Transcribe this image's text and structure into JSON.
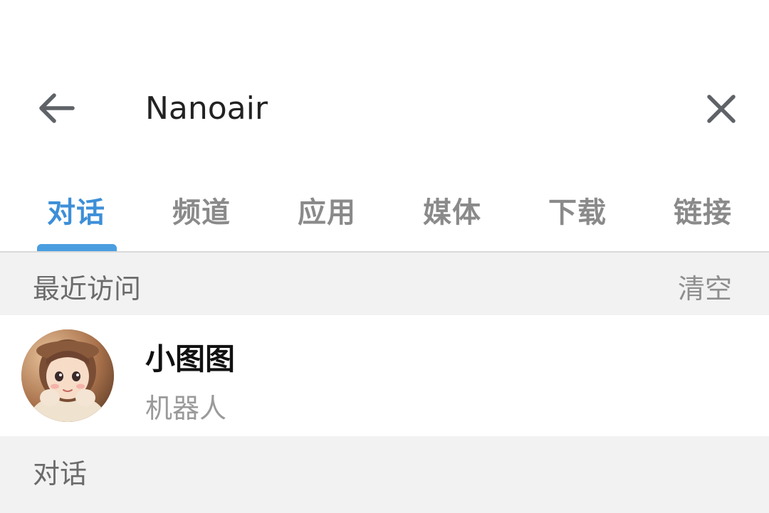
{
  "search": {
    "query": "Nanoair",
    "back_icon": "arrow-left-icon",
    "clear_icon": "close-icon"
  },
  "tabs": [
    {
      "label": "对话",
      "active": true
    },
    {
      "label": "频道",
      "active": false
    },
    {
      "label": "应用",
      "active": false
    },
    {
      "label": "媒体",
      "active": false
    },
    {
      "label": "下载",
      "active": false
    },
    {
      "label": "链接",
      "active": false
    }
  ],
  "recent": {
    "title": "最近访问",
    "clear_label": "清空",
    "items": [
      {
        "name": "小图图",
        "subtitle": "机器人"
      }
    ]
  },
  "conversations": {
    "title": "对话"
  },
  "colors": {
    "accent": "#3d8fd8",
    "indicator": "#4a9ee0",
    "section_bg": "#f2f2f2",
    "muted_text": "#8a8a8a"
  }
}
